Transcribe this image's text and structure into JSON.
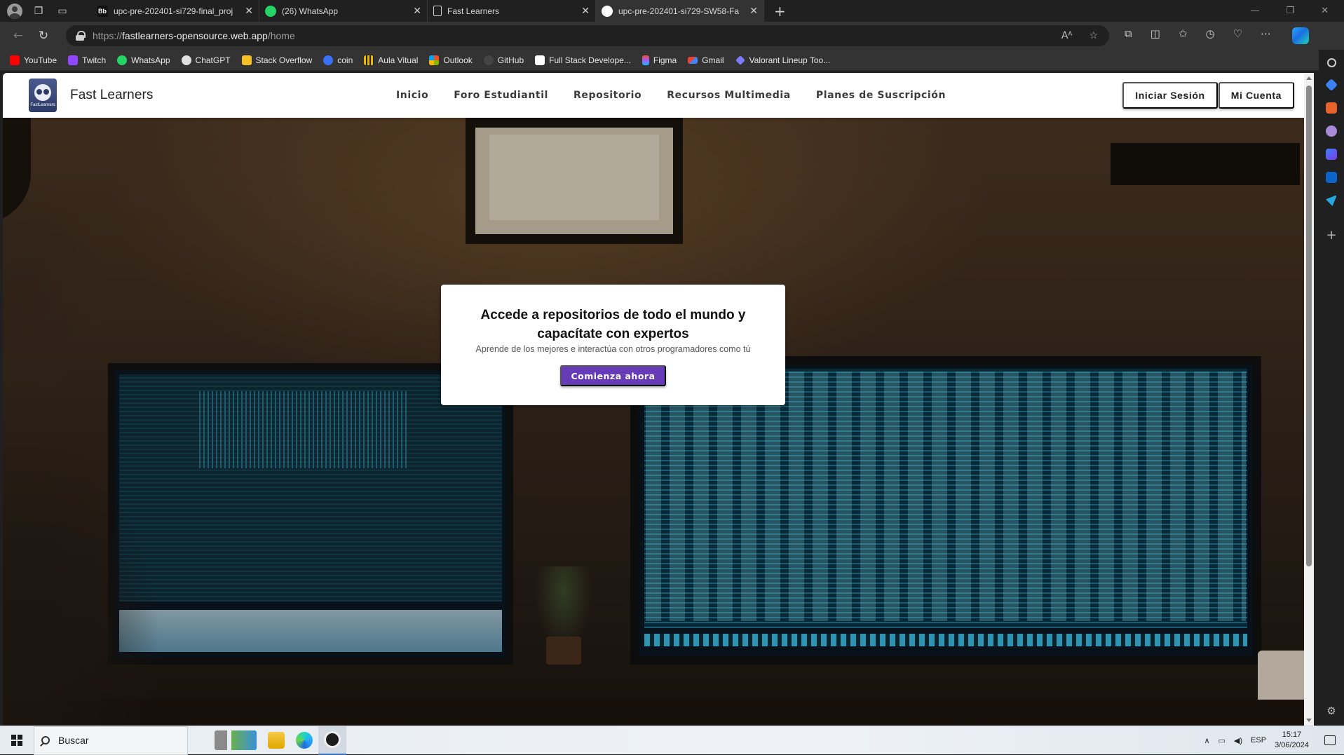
{
  "browser": {
    "tabs": [
      {
        "title": "upc-pre-202401-si729-final_proj",
        "favicon": "Bb",
        "color": "#111111",
        "fg": "#ffffff"
      },
      {
        "title": "(26) WhatsApp",
        "favicon": "",
        "color": "#25d366",
        "fg": "#ffffff"
      },
      {
        "title": "Fast Learners",
        "favicon": "",
        "color": "#cfcfcf",
        "fg": "#333333"
      },
      {
        "title": "upc-pre-202401-si729-SW58-Fa",
        "favicon": "",
        "color": "#ffffff",
        "fg": "#000000"
      }
    ],
    "active_tab_index": 3,
    "url_prefix": "https://",
    "url_host": "fastlearners-opensource.web.app",
    "url_path": "/home",
    "bookmarks": [
      {
        "label": "YouTube",
        "color": "#ff0000"
      },
      {
        "label": "Twitch",
        "color": "#9146ff"
      },
      {
        "label": "WhatsApp",
        "color": "#25d366"
      },
      {
        "label": "ChatGPT",
        "color": "#e0e0e0"
      },
      {
        "label": "Stack Overflow",
        "color": "#f48024"
      },
      {
        "label": "coin",
        "color": "#3a6ff7"
      },
      {
        "label": "Aula Vitual",
        "color": "#c8a100"
      },
      {
        "label": "Outlook",
        "color": "#e6a13b"
      },
      {
        "label": "GitHub",
        "color": "#3a3a3a"
      },
      {
        "label": "Full Stack Develope...",
        "color": "#ffffff"
      },
      {
        "label": "Figma",
        "color": "#f24e1e"
      },
      {
        "label": "Gmail",
        "color": "#ea4335"
      },
      {
        "label": "Valorant Lineup Too...",
        "color": "#7b7bff"
      }
    ]
  },
  "app": {
    "brand": "Fast Learners",
    "logo_caption": "FastLearners",
    "nav": [
      "Inicio",
      "Foro Estudiantil",
      "Repositorio",
      "Recursos Multimedia",
      "Planes de Suscripción"
    ],
    "login": "Iniciar Sesión",
    "account": "Mi Cuenta",
    "accent": "#673ab7"
  },
  "hero": {
    "title": "Accede a repositorios de todo el mundo y capacítate con expertos",
    "subtitle": "Aprende de los mejores e interactúa con otros programadores como tú",
    "cta": "Comienza ahora"
  },
  "taskbar": {
    "search_placeholder": "Buscar",
    "language": "ESP",
    "time": "15:17",
    "date": "3/06/2024"
  }
}
